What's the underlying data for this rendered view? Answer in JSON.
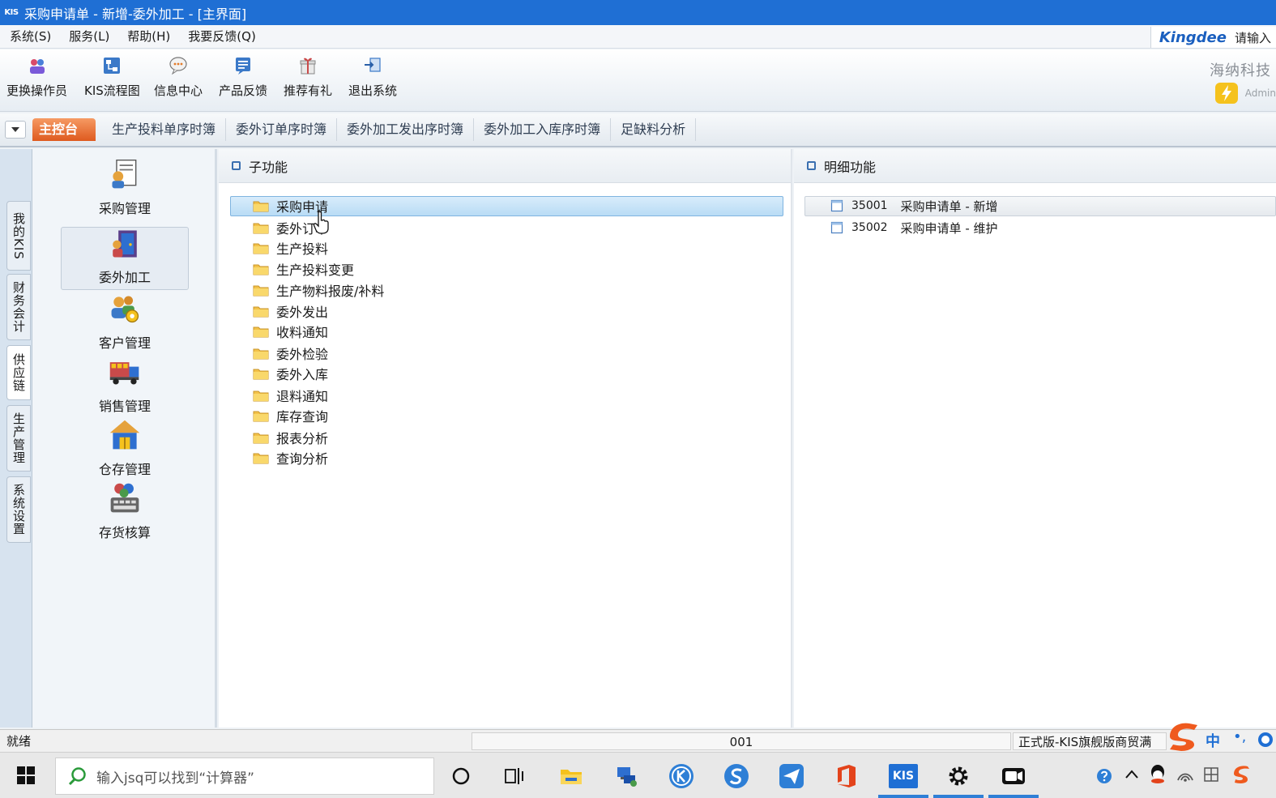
{
  "window": {
    "app_icon_text": "KIS",
    "title": "采购申请单 - 新增-委外加工 - [主界面]"
  },
  "menu": {
    "items": [
      "系统(S)",
      "服务(L)",
      "帮助(H)",
      "我要反馈(Q)"
    ],
    "brand_logo": "Kingdee",
    "brand_hint": "请输入"
  },
  "toolbar": {
    "buttons": [
      {
        "label": "更换操作员",
        "icon": "switch-user-icon"
      },
      {
        "label": "KIS流程图",
        "icon": "flowchart-icon"
      },
      {
        "label": "信息中心",
        "icon": "message-center-icon"
      },
      {
        "label": "产品反馈",
        "icon": "feedback-icon"
      },
      {
        "label": "推荐有礼",
        "icon": "gift-icon"
      },
      {
        "label": "退出系统",
        "icon": "exit-icon"
      }
    ],
    "company": "海纳科技",
    "user": "Admin"
  },
  "tabs": [
    "主控台",
    "生产投料单序时簿",
    "委外订单序时簿",
    "委外加工发出序时簿",
    "委外加工入库序时簿",
    "足缺料分析"
  ],
  "vertical_tabs": [
    "我的KIS",
    "财务会计",
    "供应链",
    "生产管理",
    "系统设置"
  ],
  "modules": [
    {
      "label": "采购管理",
      "icon": "purchase-icon"
    },
    {
      "label": "委外加工",
      "icon": "outsourcing-icon"
    },
    {
      "label": "客户管理",
      "icon": "customer-icon"
    },
    {
      "label": "销售管理",
      "icon": "sales-truck-icon"
    },
    {
      "label": "仓存管理",
      "icon": "warehouse-icon"
    },
    {
      "label": "存货核算",
      "icon": "inventory-accounting-icon"
    }
  ],
  "sub_panel": {
    "header": "子功能",
    "items": [
      "采购申请",
      "委外订单",
      "生产投料",
      "生产投料变更",
      "生产物料报废/补料",
      "委外发出",
      "收料通知",
      "委外检验",
      "委外入库",
      "退料通知",
      "库存查询",
      "报表分析",
      "查询分析"
    ]
  },
  "detail_panel": {
    "header": "明细功能",
    "items": [
      {
        "code": "35001",
        "label": "采购申请单 - 新增"
      },
      {
        "code": "35002",
        "label": "采购申请单 - 维护"
      }
    ]
  },
  "status": {
    "left": "就绪",
    "middle": "001",
    "right": "正式版-KIS旗舰版商贸满"
  },
  "taskbar": {
    "search_placeholder": "输入jsq可以找到“计算器”",
    "app_chip": "KIS",
    "ime_label": "中"
  },
  "colors": {
    "titlebar": "#1f6fd4",
    "active_tab": "#de5a1f",
    "selection": "#b9dcf5"
  }
}
